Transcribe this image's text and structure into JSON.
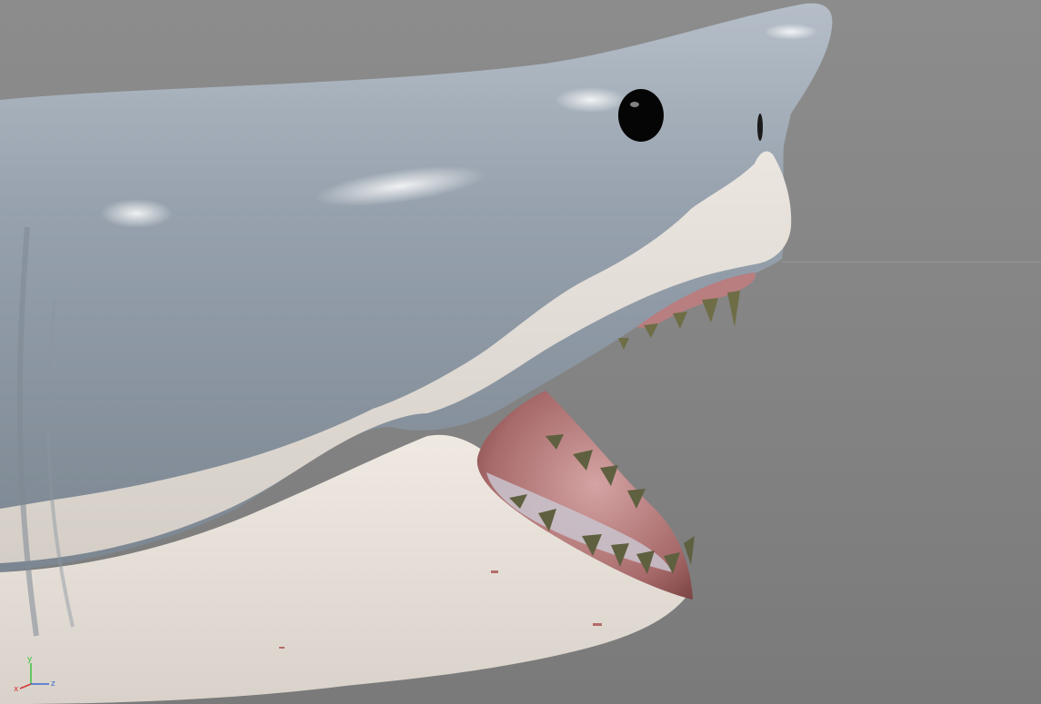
{
  "viewport": {
    "background_color": "#858585",
    "subject": "shark-head-model",
    "colors": {
      "skin_gray": "#8f9aa6",
      "belly_white": "#e6e0d8",
      "gum_pink": "#c98a8a",
      "teeth": "#6e6d46",
      "eye": "#050505"
    }
  },
  "axis_gizmo": {
    "x_label": "x",
    "y_label": "y",
    "z_label": "z",
    "x_color": "#d23a3a",
    "y_color": "#3cc23c",
    "z_color": "#3a6ad2"
  }
}
